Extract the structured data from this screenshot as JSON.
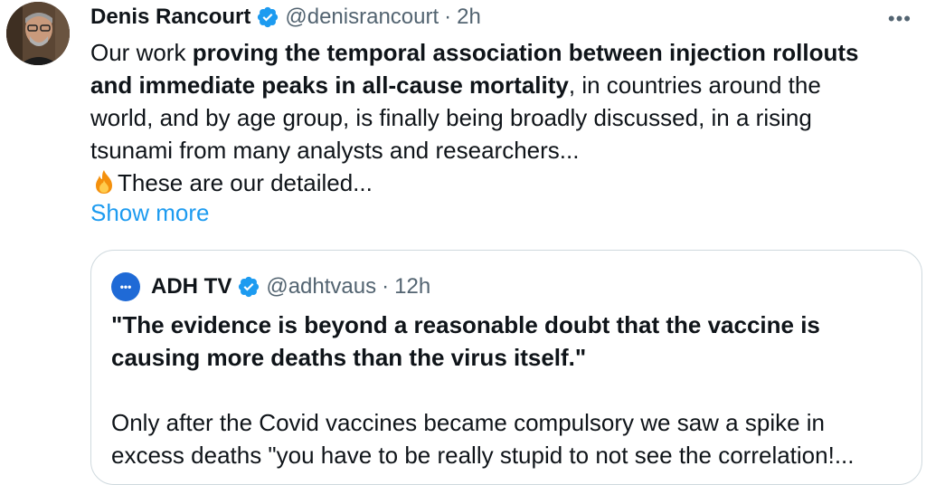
{
  "author": {
    "name": "Denis Rancourt",
    "handle": "@denisrancourt",
    "dot": "·",
    "time": "2h"
  },
  "more_label": "•••",
  "tweet": {
    "line1_plain": "Our work ",
    "line1_bold": "proving the temporal association between injection rollouts",
    "line2_bold": "and immediate peaks in all-cause mortality",
    "line2_plain": ", in countries around the",
    "line3": "world, and by age group, is finally being broadly discussed, in a rising",
    "line4": "tsunami from many analysts and researchers...",
    "line5": "These are our detailed..."
  },
  "show_more": "Show more",
  "quoted": {
    "avatar_text": "•••",
    "name": "ADH TV",
    "handle": "@adhtvaus",
    "dot": "·",
    "time": "12h",
    "bold_line1": "\"The evidence is beyond a reasonable doubt that the vaccine is",
    "bold_line2": "causing more deaths than the virus itself.\"",
    "line3": "Only after the Covid vaccines became compulsory we saw a spike in",
    "line4": "excess deaths \"you have to be really stupid to not see the correlation!..."
  },
  "colors": {
    "accent": "#1d9bf0",
    "secondary_text": "#536471",
    "border": "#cfd9de"
  }
}
